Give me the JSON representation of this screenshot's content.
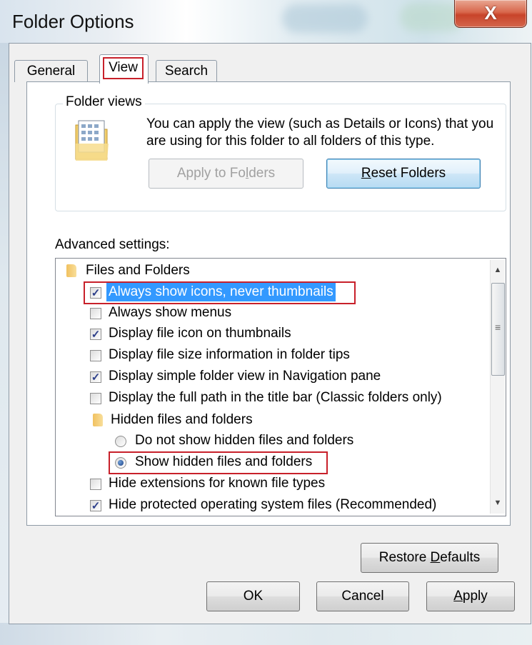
{
  "window": {
    "title": "Folder Options",
    "close_glyph": "X"
  },
  "tabs": [
    {
      "label": "General",
      "selected": false
    },
    {
      "label": "View",
      "selected": true
    },
    {
      "label": "Search",
      "selected": false
    }
  ],
  "folder_views": {
    "label": "Folder views",
    "description": "You can apply the view (such as Details or Icons) that you are using for this folder to all folders of this type.",
    "icon": "folder-view-icon",
    "apply_button": {
      "pre": "Apply to Fo",
      "accel": "l",
      "post": "ders",
      "enabled": false
    },
    "reset_button": {
      "pre": "",
      "accel": "R",
      "post": "eset Folders",
      "enabled": true
    }
  },
  "advanced": {
    "label": "Advanced settings:",
    "items": [
      {
        "type": "folder",
        "label": "Files and Folders"
      },
      {
        "type": "checkbox",
        "label": "Always show icons, never thumbnails",
        "checked": true,
        "selected": true
      },
      {
        "type": "checkbox",
        "label": "Always show menus",
        "checked": false
      },
      {
        "type": "checkbox",
        "label": "Display file icon on thumbnails",
        "checked": true
      },
      {
        "type": "checkbox",
        "label": "Display file size information in folder tips",
        "checked": false
      },
      {
        "type": "checkbox",
        "label": "Display simple folder view in Navigation pane",
        "checked": true
      },
      {
        "type": "checkbox",
        "label": "Display the full path in the title bar (Classic folders only)",
        "checked": false
      },
      {
        "type": "folder",
        "label": "Hidden files and folders"
      },
      {
        "type": "radio",
        "label": "Do not show hidden files and folders",
        "checked": false
      },
      {
        "type": "radio",
        "label": "Show hidden files and folders",
        "checked": true
      },
      {
        "type": "checkbox",
        "label": "Hide extensions for known file types",
        "checked": false
      },
      {
        "type": "checkbox",
        "label": "Hide protected operating system files (Recommended)",
        "checked": true
      }
    ],
    "check_glyph": "✓",
    "scroll_up_glyph": "▲",
    "scroll_down_glyph": "▼",
    "scroll_grip_glyph": "≡"
  },
  "restore_button": {
    "pre": "Restore ",
    "accel": "D",
    "post": "efaults"
  },
  "footer": {
    "ok": "OK",
    "cancel": "Cancel",
    "apply": {
      "pre": "",
      "accel": "A",
      "post": "pply"
    }
  }
}
